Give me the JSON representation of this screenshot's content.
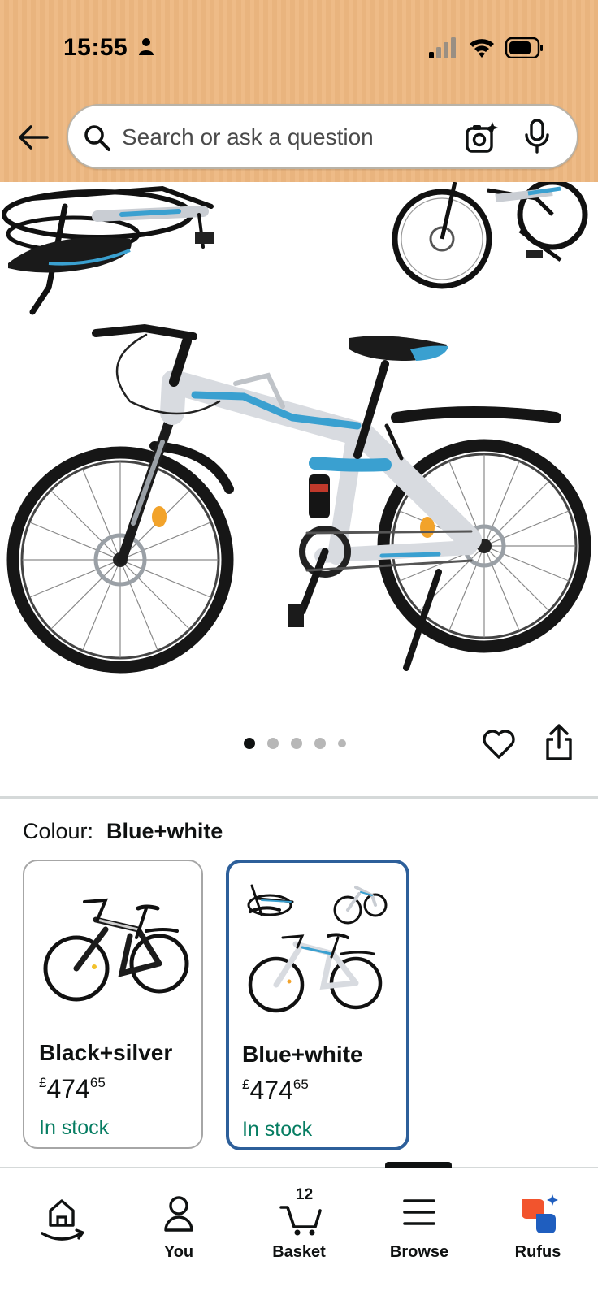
{
  "status_bar": {
    "time": "15:55",
    "icons": [
      "person-icon",
      "cellular-signal-icon",
      "wifi-icon",
      "battery-icon"
    ]
  },
  "header": {
    "back_icon": "arrow-left-icon",
    "search": {
      "placeholder": "Search or ask a question",
      "value": "",
      "left_icon": "search-icon",
      "right_icons": [
        "camera-sparkle-icon",
        "microphone-icon"
      ]
    },
    "background_color": "#eebb87"
  },
  "gallery": {
    "image": "folding-mountain-bike-blue-white",
    "dots_total": 5,
    "active_dot": 0,
    "actions": [
      "heart-icon",
      "share-icon"
    ]
  },
  "variation": {
    "label": "Colour:",
    "selected_value": "Blue+white",
    "options": [
      {
        "name": "Black+silver",
        "currency": "£",
        "price_whole": "474",
        "price_fraction": "65",
        "availability": "In stock",
        "selected": false
      },
      {
        "name": "Blue+white",
        "currency": "£",
        "price_whole": "474",
        "price_fraction": "65",
        "availability": "In stock",
        "selected": true
      }
    ],
    "selected_border_color": "#2d5f9a",
    "stock_color": "#067d62"
  },
  "bottom_nav": {
    "items": [
      {
        "label": "",
        "icon": "home-smile-icon"
      },
      {
        "label": "You",
        "icon": "person-icon"
      },
      {
        "label": "Basket",
        "icon": "cart-icon",
        "count": "12"
      },
      {
        "label": "Browse",
        "icon": "menu-icon"
      },
      {
        "label": "Rufus",
        "icon": "rufus-chat-icon"
      }
    ]
  }
}
